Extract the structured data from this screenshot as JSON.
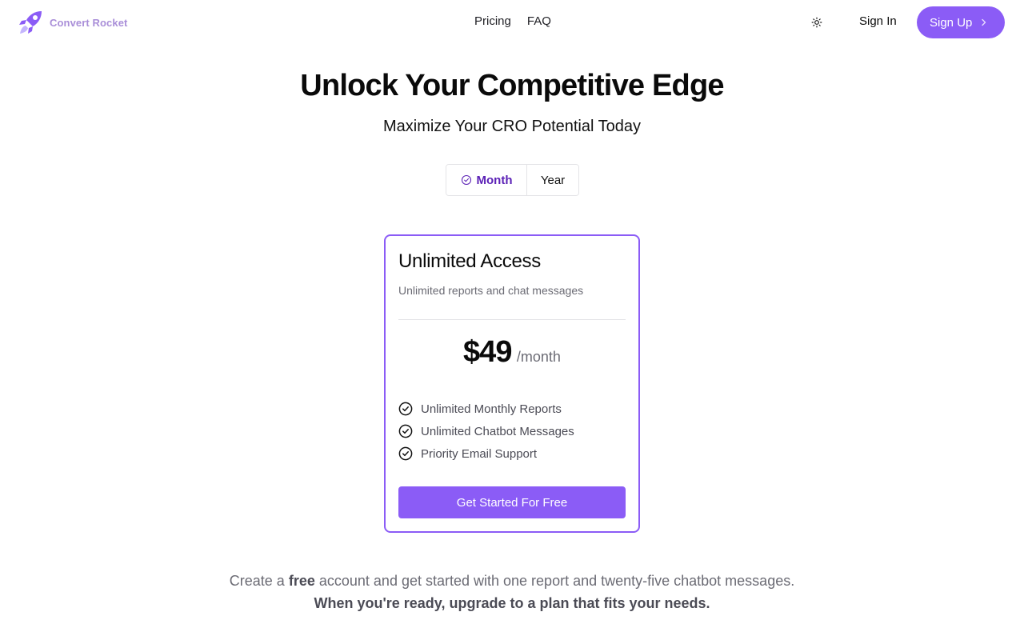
{
  "header": {
    "brand_name": "Convert Rocket",
    "nav": [
      "Pricing",
      "FAQ"
    ],
    "sign_in": "Sign In",
    "sign_up": "Sign Up"
  },
  "hero": {
    "title": "Unlock Your Competitive Edge",
    "subtitle": "Maximize Your CRO Potential Today"
  },
  "billing_toggle": {
    "options": [
      "Month",
      "Year"
    ],
    "selected": "Month"
  },
  "plan": {
    "name": "Unlimited Access",
    "description": "Unlimited reports and chat messages",
    "price": "$49",
    "period": "/month",
    "features": [
      "Unlimited Monthly Reports",
      "Unlimited Chatbot Messages",
      "Priority Email Support"
    ],
    "cta": "Get Started For Free"
  },
  "footer_note": {
    "line1_prefix": "Create a",
    "line1_bold": "free",
    "line1_suffix": "account and get started with one report and twenty-five chatbot messages.",
    "line2": "When you're ready, upgrade to a plan that fits your needs."
  },
  "colors": {
    "accent": "#8b5cf6",
    "accent_dark": "#5b21b6",
    "brand_text": "#a98ed8"
  },
  "icons": {
    "logo": "rocket-icon",
    "theme": "sun-icon",
    "sign_up": "chevron-right-icon",
    "month_selected": "check-circle-icon",
    "feature": "check-circle-icon"
  }
}
